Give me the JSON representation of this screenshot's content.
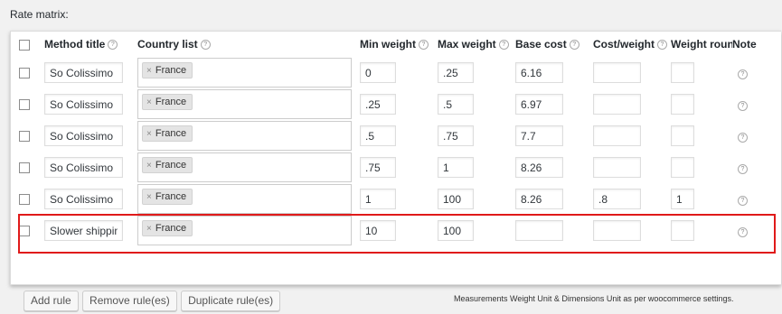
{
  "section_title": "Rate matrix:",
  "columns": {
    "method_title": "Method title",
    "country_list": "Country list",
    "min_weight": "Min weight",
    "max_weight": "Max weight",
    "base_cost": "Base cost",
    "cost_weight": "Cost/weight",
    "weight_round": "Weight round",
    "note": "Note"
  },
  "help_glyph": "?",
  "token_remove_glyph": "×",
  "rows": [
    {
      "method": "So Colissimo",
      "country": "France",
      "min": "0",
      "max": ".25",
      "base": "6.16",
      "cost_weight": "",
      "weight_round": ""
    },
    {
      "method": "So Colissimo",
      "country": "France",
      "min": ".25",
      "max": ".5",
      "base": "6.97",
      "cost_weight": "",
      "weight_round": ""
    },
    {
      "method": "So Colissimo",
      "country": "France",
      "min": ".5",
      "max": ".75",
      "base": "7.7",
      "cost_weight": "",
      "weight_round": ""
    },
    {
      "method": "So Colissimo",
      "country": "France",
      "min": ".75",
      "max": "1",
      "base": "8.26",
      "cost_weight": "",
      "weight_round": ""
    },
    {
      "method": "So Colissimo",
      "country": "France",
      "min": "1",
      "max": "100",
      "base": "8.26",
      "cost_weight": ".8",
      "weight_round": "1"
    },
    {
      "method": "Slower shippin",
      "country": "France",
      "min": "10",
      "max": "100",
      "base": "",
      "cost_weight": "",
      "weight_round": ""
    }
  ],
  "buttons": {
    "add_rule": "Add rule",
    "remove_rules": "Remove rule(es)",
    "duplicate_rules": "Duplicate rule(es)"
  },
  "footnote": "Measurements Weight Unit & Dimensions Unit as per woocommerce settings.",
  "highlight_color": "#e01a1a",
  "icons": {
    "help": "help-icon",
    "remove": "close-icon"
  }
}
